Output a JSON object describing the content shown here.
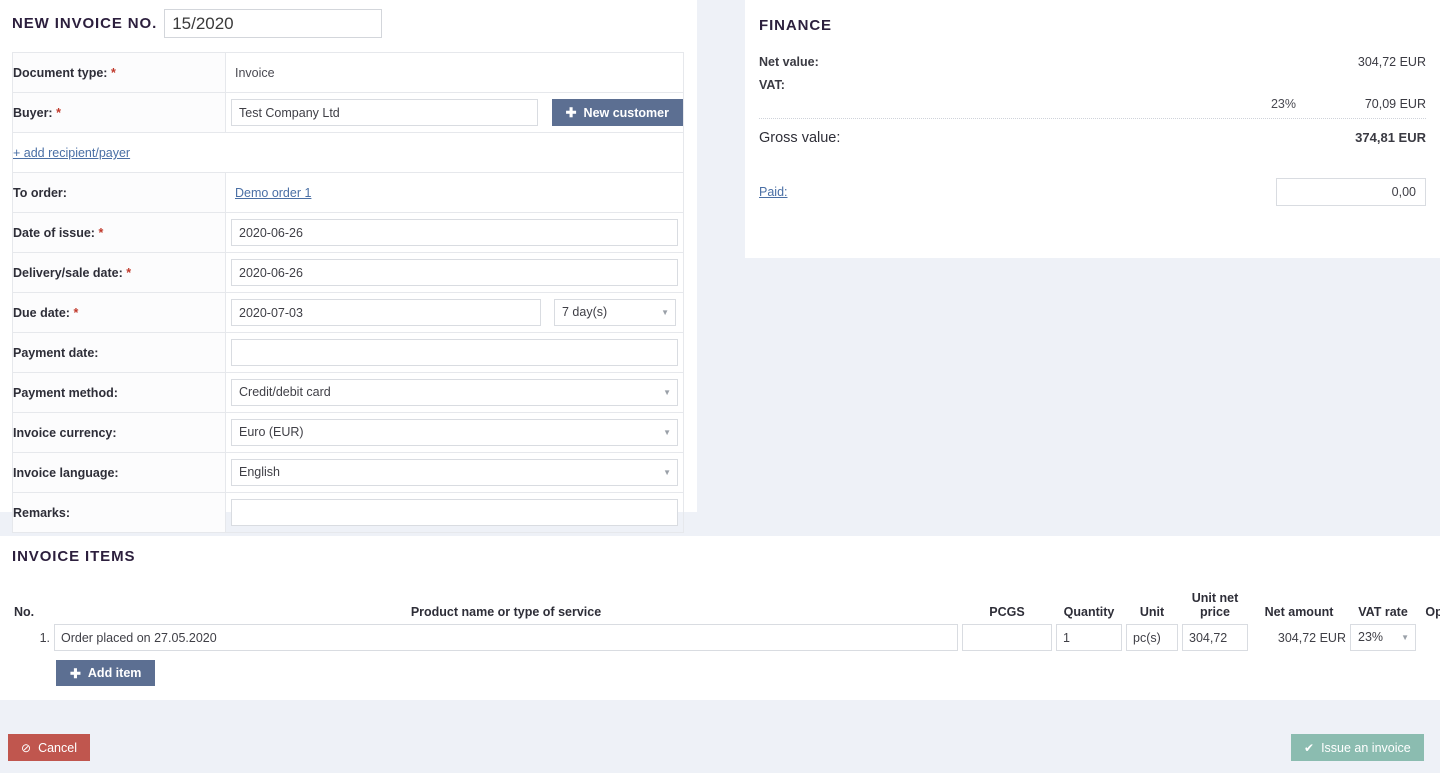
{
  "form": {
    "title": "NEW INVOICE NO.",
    "invoice_number": "15/2020",
    "rows": {
      "document_type": {
        "label": "Document type:",
        "required": "*",
        "value": "Invoice"
      },
      "buyer": {
        "label": "Buyer:",
        "required": "*",
        "value": "Test Company Ltd",
        "new_customer_label": "New customer"
      },
      "add_recipient": {
        "label": "+ add recipient/payer"
      },
      "to_order": {
        "label": "To order:",
        "value": "Demo order 1"
      },
      "date_of_issue": {
        "label": "Date of issue:",
        "required": "*",
        "value": "2020-06-26"
      },
      "delivery_date": {
        "label": "Delivery/sale date:",
        "required": "*",
        "value": "2020-06-26"
      },
      "due_date": {
        "label": "Due date:",
        "required": "*",
        "value": "2020-07-03",
        "term": "7 day(s)"
      },
      "payment_date": {
        "label": "Payment date:",
        "value": ""
      },
      "payment_method": {
        "label": "Payment method:",
        "value": "Credit/debit card"
      },
      "invoice_currency": {
        "label": "Invoice currency:",
        "value": "Euro (EUR)"
      },
      "invoice_language": {
        "label": "Invoice language:",
        "value": "English"
      },
      "remarks": {
        "label": "Remarks:",
        "value": ""
      }
    }
  },
  "finance": {
    "title": "FINANCE",
    "net_label": "Net value:",
    "net_value": "304,72 EUR",
    "vat_label": "VAT:",
    "vat_rate": "23%",
    "vat_amount": "70,09 EUR",
    "gross_label": "Gross value:",
    "gross_value": "374,81 EUR",
    "paid_label": "Paid:",
    "paid_value": "0,00"
  },
  "items": {
    "title": "INVOICE ITEMS",
    "headers": {
      "no": "No.",
      "name": "Product name or type of service",
      "pcgs": "PCGS",
      "quantity": "Quantity",
      "unit": "Unit",
      "unit_net_price": "Unit net price",
      "net_amount": "Net amount",
      "vat_rate": "VAT rate",
      "options": "Options"
    },
    "rows": [
      {
        "no": "1.",
        "name": "Order placed on 27.05.2020",
        "pcgs": "",
        "quantity": "1",
        "unit": "pc(s)",
        "unit_net_price": "304,72",
        "net_amount": "304,72 EUR",
        "vat_rate": "23%"
      }
    ],
    "add_item_label": "Add item"
  },
  "footer": {
    "cancel_label": "Cancel",
    "issue_label": "Issue an invoice"
  },
  "colors": {
    "page_background": "#eef1f7",
    "primary_button": "#5c6f92",
    "cancel_button": "#c0564e",
    "issue_button": "#8bbcb0",
    "link": "#4a6fa5",
    "required_asterisk": "#c0392b",
    "heading": "#2c1f3d",
    "delete_icon": "#a33c25"
  }
}
